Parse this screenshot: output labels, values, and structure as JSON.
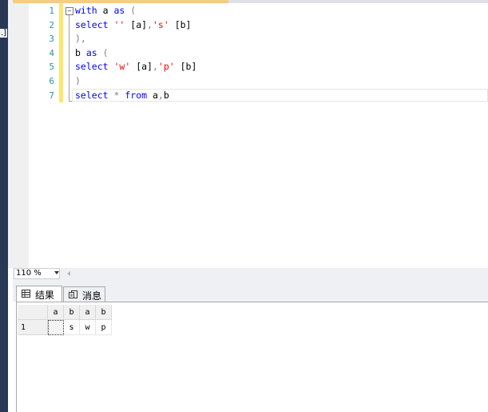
{
  "editor": {
    "line_numbers": [
      "1",
      "2",
      "3",
      "4",
      "5",
      "6",
      "7"
    ],
    "lines": [
      [
        {
          "t": "with",
          "c": "kw"
        },
        {
          "t": " a ",
          "c": ""
        },
        {
          "t": "as",
          "c": "kw"
        },
        {
          "t": " (",
          "c": "op"
        }
      ],
      [
        {
          "t": "select",
          "c": "kw"
        },
        {
          "t": " ",
          "c": ""
        },
        {
          "t": "''",
          "c": "str"
        },
        {
          "t": " [a]",
          "c": ""
        },
        {
          "t": ",",
          "c": "op"
        },
        {
          "t": "'s'",
          "c": "str"
        },
        {
          "t": " [b]",
          "c": ""
        }
      ],
      [
        {
          "t": "),",
          "c": "op"
        }
      ],
      [
        {
          "t": "b ",
          "c": ""
        },
        {
          "t": "as",
          "c": "kw"
        },
        {
          "t": " (",
          "c": "op"
        }
      ],
      [
        {
          "t": "select",
          "c": "kw"
        },
        {
          "t": " ",
          "c": ""
        },
        {
          "t": "'w'",
          "c": "str"
        },
        {
          "t": " [a]",
          "c": ""
        },
        {
          "t": ",",
          "c": "op"
        },
        {
          "t": "'p'",
          "c": "str"
        },
        {
          "t": " [b]",
          "c": ""
        }
      ],
      [
        {
          "t": ")",
          "c": "op"
        }
      ],
      [
        {
          "t": "select",
          "c": "kw"
        },
        {
          "t": " ",
          "c": ""
        },
        {
          "t": "*",
          "c": "op"
        },
        {
          "t": " ",
          "c": ""
        },
        {
          "t": "from",
          "c": "kw"
        },
        {
          "t": " a",
          "c": ""
        },
        {
          "t": ",",
          "c": "op"
        },
        {
          "t": "b",
          "c": ""
        }
      ]
    ],
    "fold_symbol": "−"
  },
  "left_fragment": ".]",
  "zoom": {
    "value": "110 %"
  },
  "results_tabs": [
    {
      "label": "结果",
      "icon": "grid-icon",
      "active": true
    },
    {
      "label": "消息",
      "icon": "messages-icon",
      "active": false
    }
  ],
  "grid": {
    "columns": [
      "a",
      "b",
      "a",
      "b"
    ],
    "rows": [
      {
        "row_number": "1",
        "cells": [
          "",
          "s",
          "w",
          "p"
        ]
      }
    ]
  },
  "colors": {
    "keyword": "#0000ff",
    "string": "#ff0000",
    "operator": "#808080",
    "line_number": "#2b91af",
    "change_bar": "#ffe56b",
    "tab_strip": "#f5cc84",
    "left_bar": "#293955"
  }
}
